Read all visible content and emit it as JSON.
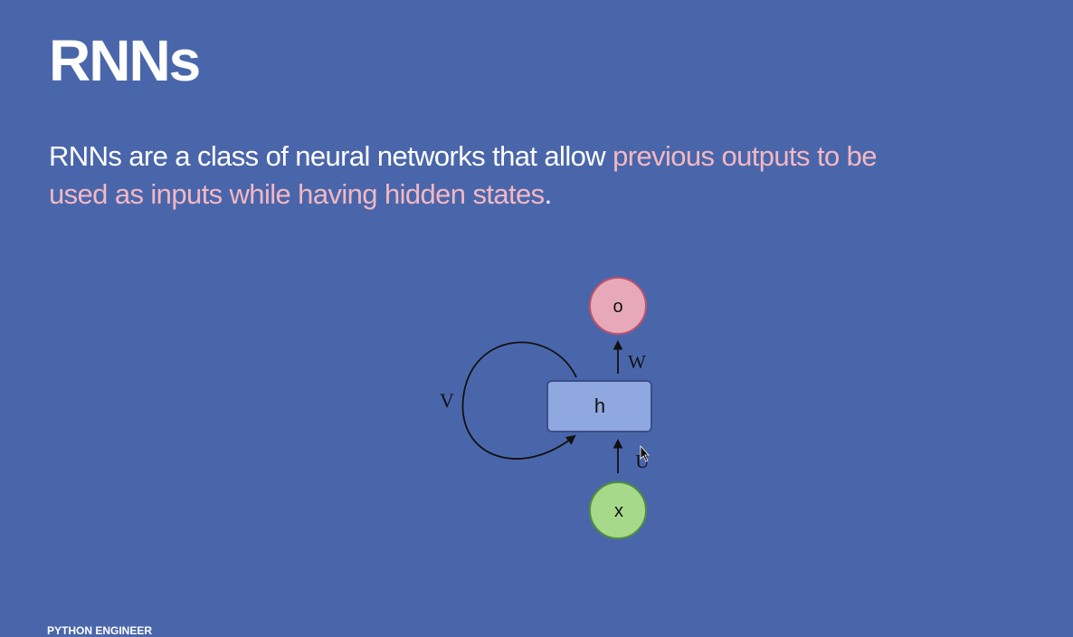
{
  "slide": {
    "title": "RNNs",
    "text_plain_1": "RNNs are a class of neural networks that allow ",
    "text_highlight": "previous outputs to be used as inputs while having hidden states",
    "text_plain_2": "."
  },
  "diagram": {
    "nodes": {
      "output": "o",
      "hidden": "h",
      "input": "x"
    },
    "edge_labels": {
      "recurrent": "V",
      "output": "W",
      "input": "U"
    }
  },
  "footer": "PYTHON ENGINEER",
  "colors": {
    "background": "#4a66ab",
    "highlight": "#f2b8c2",
    "output_node": "#e7a9b9",
    "hidden_node": "#8fa8e0",
    "input_node": "#a7d98a"
  }
}
